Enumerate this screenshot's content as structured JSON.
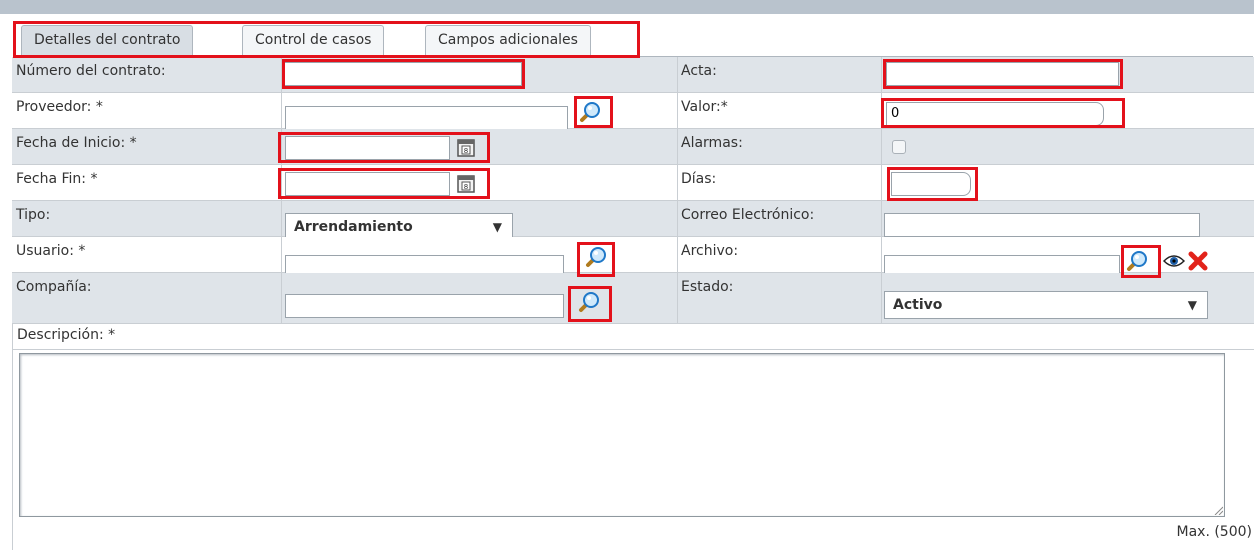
{
  "tabs": [
    {
      "label": "Detalles del contrato",
      "active": true
    },
    {
      "label": "Control de casos",
      "active": false
    },
    {
      "label": "Campos adicionales",
      "active": false
    }
  ],
  "form": {
    "numero": {
      "label": "Número del contrato:",
      "value": ""
    },
    "acta": {
      "label": "Acta:",
      "value": ""
    },
    "proveedor": {
      "label": "Proveedor: *",
      "value": ""
    },
    "valor": {
      "label": "Valor:*",
      "value": "0"
    },
    "fecha_inicio": {
      "label": "Fecha de Inicio: *",
      "value": ""
    },
    "alarmas": {
      "label": "Alarmas:",
      "checked": false
    },
    "fecha_fin": {
      "label": "Fecha Fin: *",
      "value": ""
    },
    "dias": {
      "label": "Días:",
      "value": ""
    },
    "tipo": {
      "label": "Tipo:",
      "selected": "Arrendamiento"
    },
    "correo": {
      "label": "Correo Electrónico:",
      "value": ""
    },
    "usuario": {
      "label": "Usuario: *",
      "value": ""
    },
    "archivo": {
      "label": "Archivo:",
      "value": ""
    },
    "compania": {
      "label": "Compañía:",
      "value": ""
    },
    "estado": {
      "label": "Estado:",
      "selected": "Activo"
    },
    "descripcion": {
      "label": "Descripción:  *",
      "value": "",
      "max_label": "Max. (500)"
    }
  },
  "icons": {
    "search": "magnifier-icon",
    "calendar": "calendar-icon",
    "view": "eye-icon",
    "delete": "red-x-icon"
  },
  "colors": {
    "highlight": "#e3111b",
    "row_alt": "#dfe4e9",
    "topbar": "#b9c3cd"
  }
}
